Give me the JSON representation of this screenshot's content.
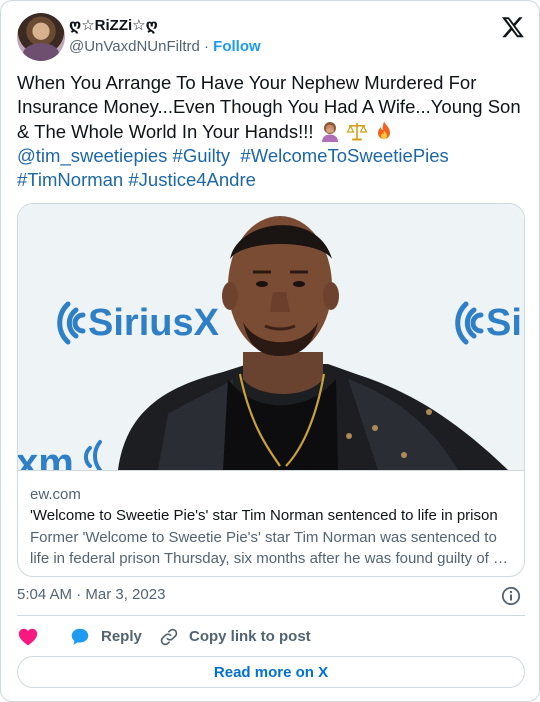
{
  "author": {
    "display_name": "ღ☆RiZZi☆ღ",
    "handle": "@UnVaxdNUnFiltrd",
    "separator": "·",
    "follow_label": "Follow"
  },
  "tweet": {
    "text_main": "When You Arrange To Have Your Nephew Murdered For Insurance Money...Even Though You Had A Wife...Young Son & The Whole World In Your Hands!!! ",
    "emojis": [
      "woman-facepalming-emoji",
      "balance-scale-emoji",
      "fire-emoji"
    ],
    "links": [
      "@tim_sweetiepies",
      "#Guilty",
      "#WelcomeToSweetiePies",
      "#TimNorman",
      "#Justice4Andre"
    ]
  },
  "embed": {
    "image_sign_left": "SiriusX",
    "image_sign_right": "Si",
    "image_sign_bottom": "xm",
    "domain": "ew.com",
    "headline": "'Welcome to Sweetie Pie's' star Tim Norman sentenced to life in prison",
    "description": "Former 'Welcome to Sweetie Pie's' star Tim Norman was sentenced to life in federal prison Thursday, six months after he was found guilty of …"
  },
  "meta": {
    "timestamp": "5:04 AM · Mar 3, 2023"
  },
  "actions": {
    "like_icon": "heart-icon",
    "reply_label": "Reply",
    "copy_label": "Copy link to post"
  },
  "footer": {
    "read_more_label": "Read more on X"
  },
  "colors": {
    "link": "#1d67a8",
    "accent": "#1d9bf0",
    "like": "#f91880",
    "read_more": "#006fd6",
    "sirius_blue": "#2f7fc7"
  }
}
